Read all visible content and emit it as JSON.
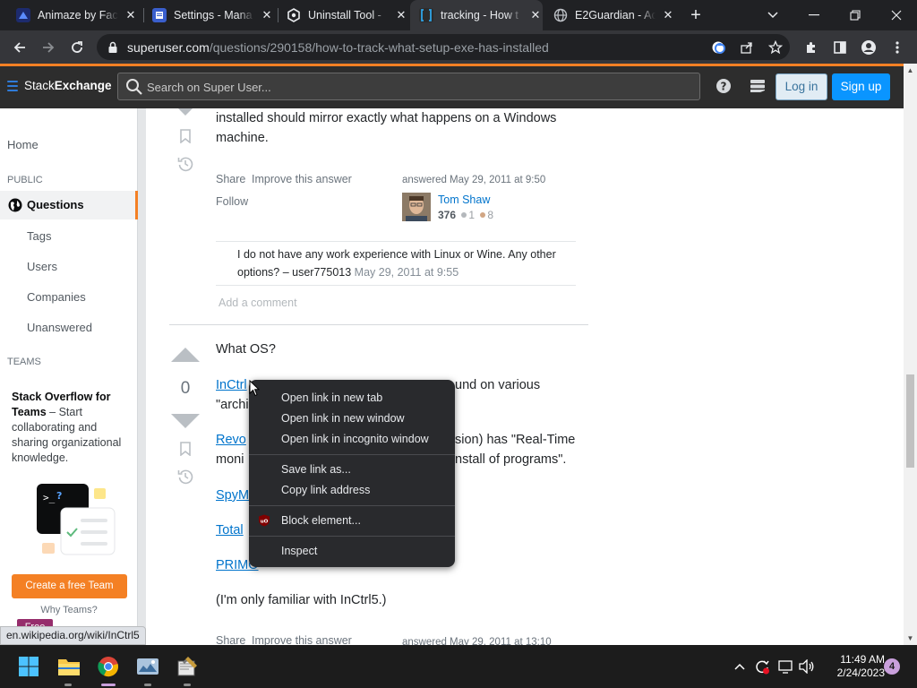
{
  "browser": {
    "tabs": [
      {
        "title": "Animaze by Face",
        "icon": "animaze-icon"
      },
      {
        "title": "Settings - Mana",
        "icon": "settings-icon"
      },
      {
        "title": "Uninstall Tool -",
        "icon": "uninstall-tool-icon"
      },
      {
        "title": "tracking - How t",
        "icon": "superuser-icon",
        "active": true
      },
      {
        "title": "E2Guardian - Ac",
        "icon": "globe-icon"
      }
    ],
    "url_host": "superuser.com",
    "url_path": "/questions/290158/how-to-track-what-setup-exe-has-installed",
    "status_url": "en.wikipedia.org/wiki/InCtrl5"
  },
  "se_header": {
    "brand_left": "Stack",
    "brand_right": "Exchange",
    "search_placeholder": "Search on Super User...",
    "login": "Log in",
    "signup": "Sign up"
  },
  "sidebar": {
    "home": "Home",
    "public_label": "PUBLIC",
    "questions": "Questions",
    "tags": "Tags",
    "users": "Users",
    "companies": "Companies",
    "unanswered": "Unanswered",
    "teams_label": "TEAMS",
    "teams_title": "Stack Overflow for Teams",
    "teams_body": " – Start collaborating and sharing organizational knowledge.",
    "free_badge": "Free",
    "create_team": "Create a free Team",
    "why_teams": "Why Teams?"
  },
  "answer1": {
    "text_line1": "installed should mirror exactly what happens on a Windows",
    "text_line2": "machine.",
    "share": "Share",
    "improve": "Improve this answer",
    "follow": "Follow",
    "answered": "answered May 29, 2011 at 9:50",
    "user_name": "Tom Shaw",
    "reputation": "376",
    "silver": "1",
    "bronze": "8",
    "comment_line1": "I do not have any work experience with Linux or Wine. Any other",
    "comment_line2": "options? – user775013",
    "comment_date": "May 29, 2011 at 9:55",
    "add_comment": "Add a comment"
  },
  "answer2": {
    "vote_count": "0",
    "what_os": "What OS?",
    "inctrl_link": "InCtrl",
    "inctrl_tail": "und on various",
    "archi": "\"archi",
    "revo_link": "Revo",
    "revo_tail": "sion) has \"Real-Time",
    "moni": "moni",
    "moni_tail": "nstall of programs\".",
    "spym_link": "SpyM",
    "total_link": "Total",
    "primo_link": "PRIMO",
    "familiar": "(I'm only familiar with InCtrl5.)",
    "share": "Share",
    "improve": "Improve this answer",
    "answered": "answered May 29, 2011 at 13:10"
  },
  "context_menu": {
    "items": [
      "Open link in new tab",
      "Open link in new window",
      "Open link in incognito window",
      "Save link as...",
      "Copy link address",
      "Block element...",
      "Inspect"
    ]
  },
  "taskbar": {
    "time": "11:49 AM",
    "date": "2/24/2023",
    "notifications": "4"
  },
  "colors": {
    "accent_orange": "#f48024",
    "link_blue": "#0074cc",
    "signup_blue": "#0a95ff"
  }
}
